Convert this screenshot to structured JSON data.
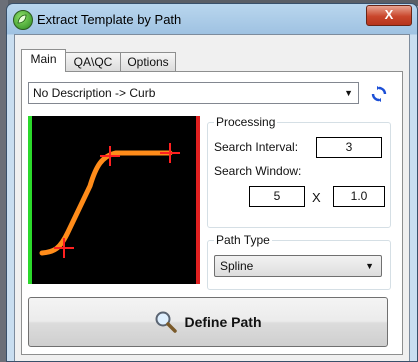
{
  "window": {
    "title": "Extract Template by Path",
    "close_label": "X"
  },
  "tabs": [
    {
      "label": "Main"
    },
    {
      "label": "QA\\QC"
    },
    {
      "label": "Options"
    }
  ],
  "template_select": {
    "value": "No Description -> Curb",
    "arrow_icon": "dropdown-arrow-icon"
  },
  "icons": {
    "refresh": "refresh-icon",
    "magnifier": "magnifier-icon",
    "app": "app-leaf-icon"
  },
  "colors": {
    "left_edge": "#2bd82b",
    "right_edge": "#e02020",
    "curve": "#ff8c1a",
    "marker": "#ff2020"
  },
  "processing": {
    "title": "Processing",
    "search_interval_label": "Search Interval:",
    "search_interval_value": "3",
    "search_window_label": "Search Window:",
    "window_x": "5",
    "times": "X",
    "window_y": "1.0"
  },
  "path_type": {
    "title": "Path Type",
    "value": "Spline"
  },
  "define_button": {
    "label": "Define Path"
  }
}
